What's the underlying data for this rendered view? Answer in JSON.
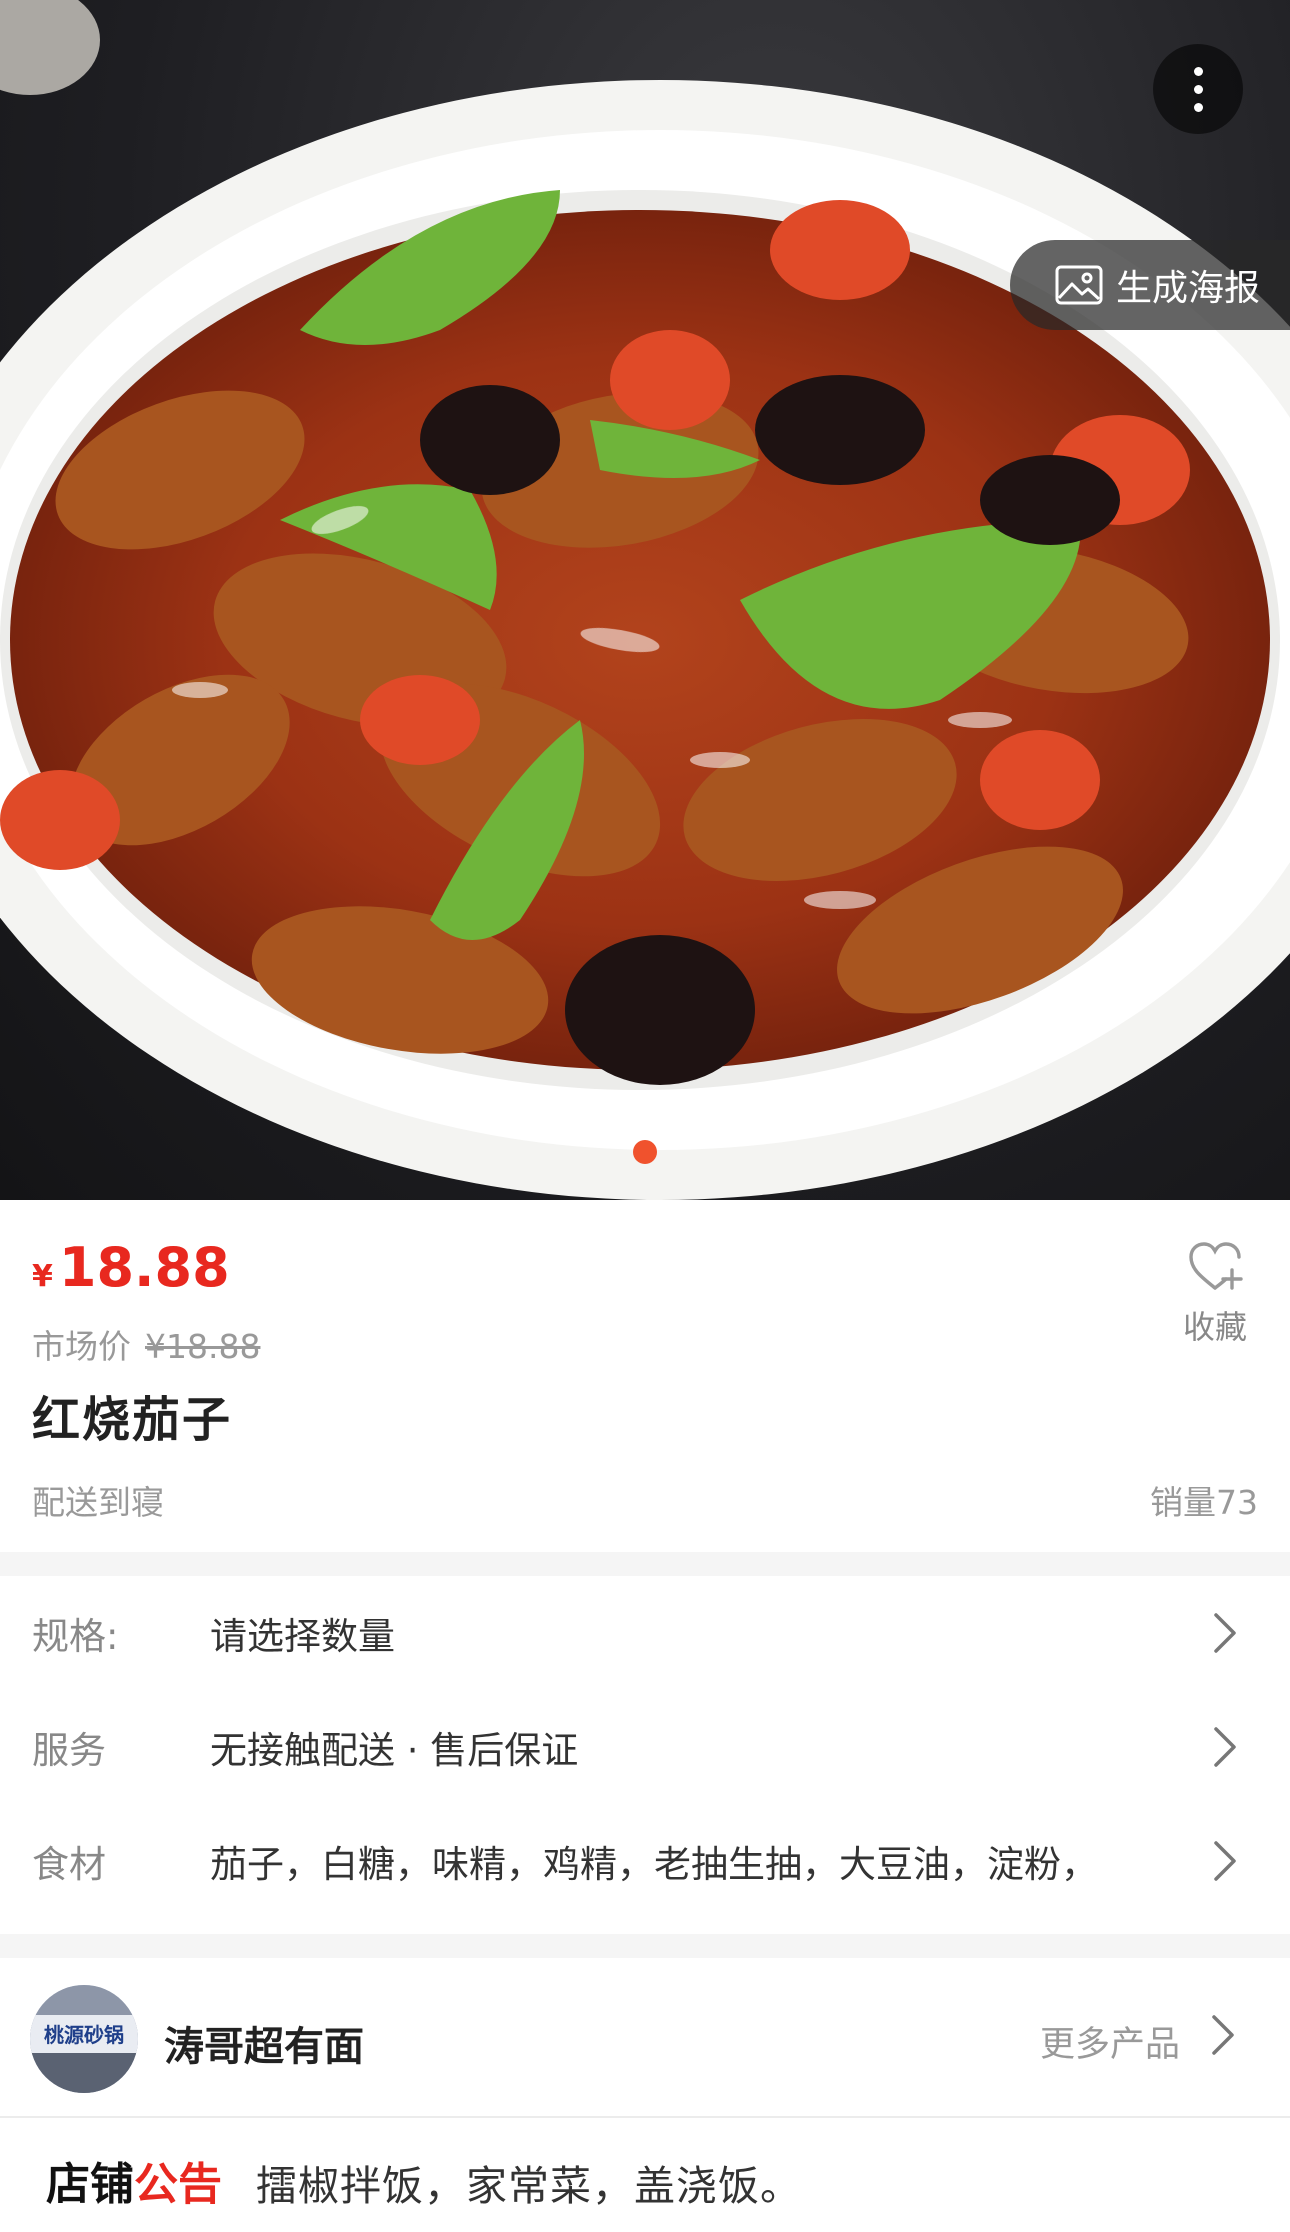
{
  "hero": {
    "poster_label": "生成海报",
    "icons": {
      "more": "more-vertical-icon",
      "poster": "image-icon"
    }
  },
  "product": {
    "currency": "¥",
    "price": "18.88",
    "market_label": "市场价",
    "market_price": "¥18.88",
    "favorite_label": "收藏",
    "title": "红烧茄子",
    "delivery": "配送到寝",
    "sales": "销量73"
  },
  "attributes": [
    {
      "key": "规格:",
      "value": "请选择数量"
    },
    {
      "key": "服务",
      "value": "无接触配送 · 售后保证"
    },
    {
      "key": "食材",
      "value": "茄子，白糖，味精，鸡精，老抽生抽，大豆油，淀粉，"
    }
  ],
  "shop": {
    "name": "涛哥超有面",
    "more_label": "更多产品",
    "avatar_text": "桃源砂锅"
  },
  "notice": {
    "label_a": "店铺",
    "label_b": "公告",
    "text": "擂椒拌饭，家常菜，盖浇饭。"
  },
  "colors": {
    "accent": "#e8281f",
    "indicator": "#f0522d",
    "muted": "#999999"
  }
}
